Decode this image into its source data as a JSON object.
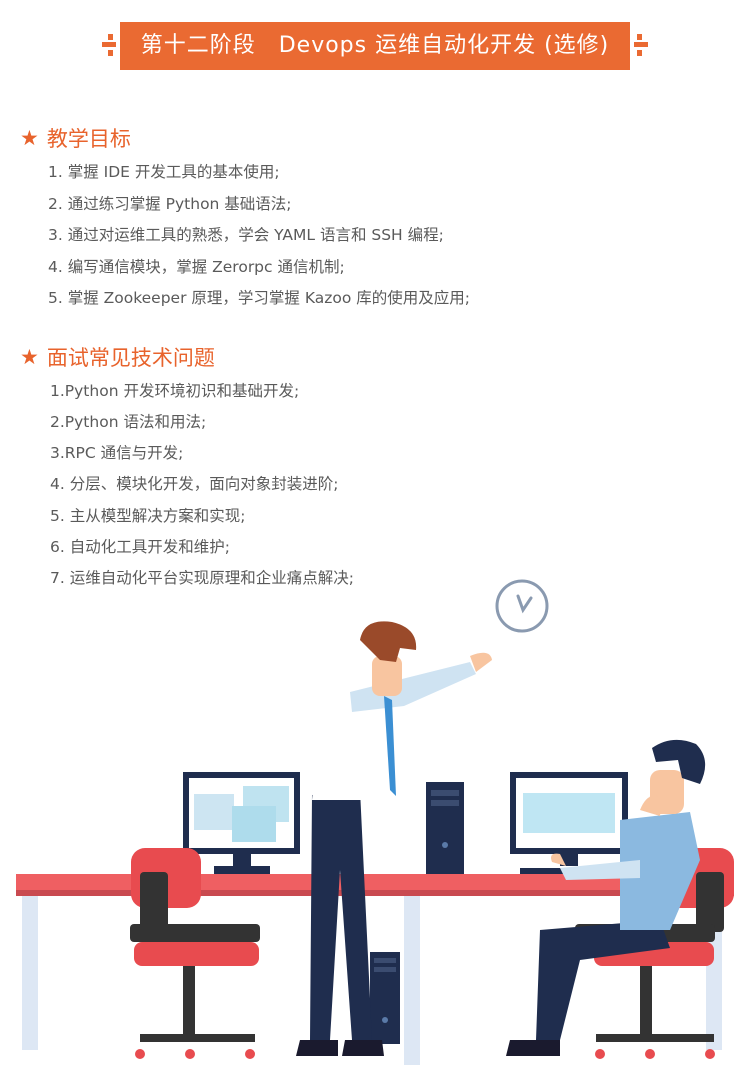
{
  "banner": {
    "title": "第十二阶段　Devops 运维自动化开发 (选修)"
  },
  "colors": {
    "accent": "#ea6a32",
    "heading": "#e8632c",
    "text": "#5a5a5a"
  },
  "teaching_goals": {
    "heading": "教学目标",
    "icon": "star-icon",
    "items": [
      "1. 掌握 IDE 开发工具的基本使用;",
      "2. 通过练习掌握 Python 基础语法;",
      "3. 通过对运维工具的熟悉，学会 YAML 语言和 SSH 编程;",
      "4. 编写通信模块，掌握 Zerorpc 通信机制;",
      "5. 掌握 Zookeeper 原理，学习掌握 Kazoo 库的使用及应用;"
    ]
  },
  "interview_questions": {
    "heading": "面试常见技术问题",
    "icon": "star-icon",
    "items": [
      "1.Python 开发环境初识和基础开发;",
      "2.Python 语法和用法;",
      "3.RPC 通信与开发;",
      "4. 分层、模块化开发，面向对象封装进阶;",
      "5. 主从模型解决方案和实现;",
      "6. 自动化工具开发和维护;",
      "7. 运维自动化平台实现原理和企业痛点解决;"
    ]
  }
}
